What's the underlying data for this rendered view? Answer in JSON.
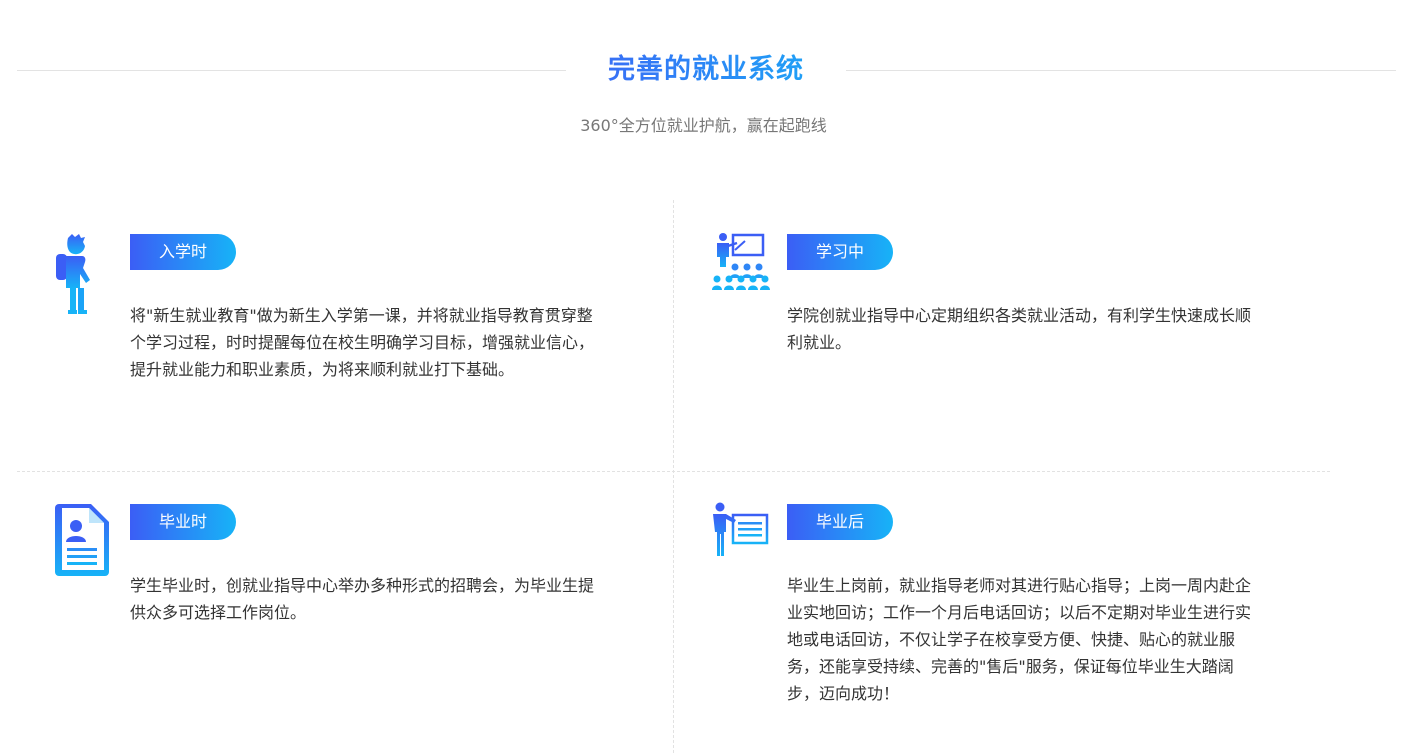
{
  "section": {
    "title": "完善的就业系统",
    "subtitle": "360°全方位就业护航，赢在起跑线"
  },
  "stages": [
    {
      "label": "入学时",
      "icon": "student-backpack-icon",
      "description": "将\"新生就业教育\"做为新生入学第一课，并将就业指导教育贯穿整个学习过程，时时提醒每位在校生明确学习目标，增强就业信心， 提升就业能力和职业素质，为将来顺利就业打下基础。"
    },
    {
      "label": "学习中",
      "icon": "classroom-teacher-icon",
      "description": "学院创就业指导中心定期组织各类就业活动，有利学生快速成长顺利就业。"
    },
    {
      "label": "毕业时",
      "icon": "resume-document-icon",
      "description": "学生毕业时，创就业指导中心举办多种形式的招聘会，为毕业生提供众多可选择工作岗位。"
    },
    {
      "label": "毕业后",
      "icon": "presenter-board-icon",
      "description": "毕业生上岗前，就业指导老师对其进行贴心指导；上岗一周内赴企业实地回访；工作一个月后电话回访；以后不定期对毕业生进行实地或电话回访，不仅让学子在校享受方便、快捷、贴心的就业服务，还能享受持续、完善的\"售后\"服务，保证每位毕业生大踏阔步，迈向成功！"
    }
  ],
  "colors": {
    "accent_start": "#3b5ef5",
    "accent_end": "#17b3f7",
    "text": "#333333",
    "muted": "#777777"
  }
}
